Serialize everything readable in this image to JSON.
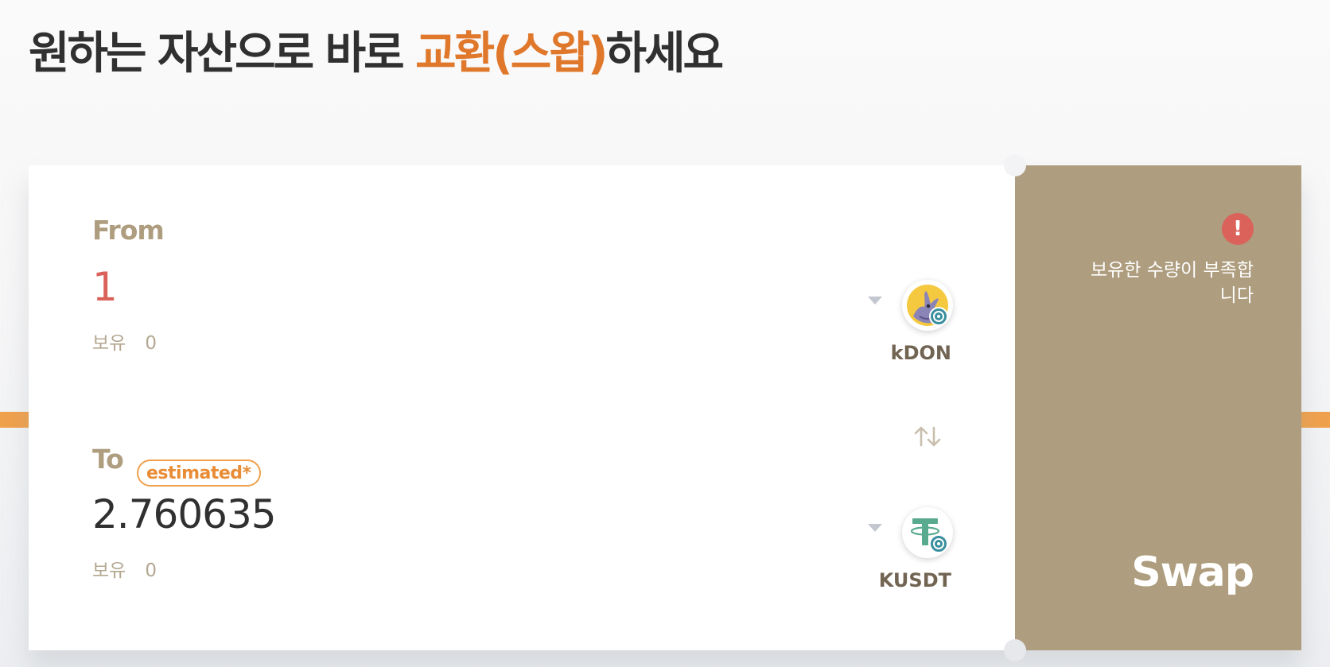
{
  "header": {
    "title_prefix": "원하는 자산으로 바로 ",
    "title_highlight": "교환(스왑)",
    "title_suffix": "하세요"
  },
  "from": {
    "label": "From",
    "amount": "1",
    "balance_label": "보유",
    "balance_value": "0",
    "token": {
      "symbol": "kDON",
      "icon": "kdon-token-icon"
    }
  },
  "to": {
    "label": "To",
    "badge": "estimated*",
    "amount": "2.760635",
    "balance_label": "보유",
    "balance_value": "0",
    "token": {
      "symbol": "KUSDT",
      "icon": "kusdt-token-icon"
    }
  },
  "action": {
    "warning": "보유한 수량이 부족합니다",
    "swap_label": "Swap"
  },
  "colors": {
    "accent_orange": "#e0782c",
    "panel_tan": "#ae9d7e",
    "error_red": "#db625b",
    "label_tan": "#ae9d7e",
    "tether_green": "#5aaa8f",
    "klaytn_teal": "#3a8f9e",
    "kdon_yellow": "#f5c93f"
  }
}
